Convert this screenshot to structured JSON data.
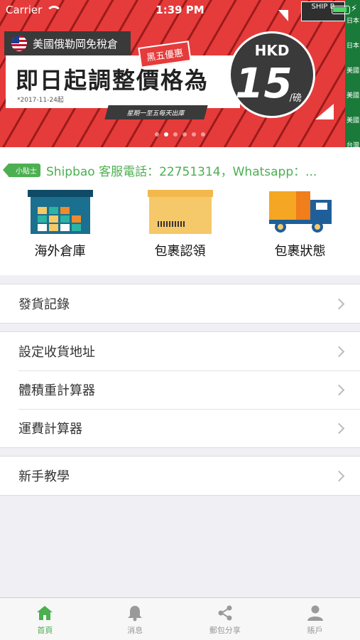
{
  "status_bar": {
    "carrier": "Carrier",
    "time": "1:39 PM"
  },
  "banner": {
    "top_tag": "美國俄勒岡免稅倉",
    "headline": "即日起調整價格為",
    "date": "*2017-11-24起",
    "promo_tag": "黑五優惠",
    "schedule": "星期一至五每天出庫",
    "currency": "HKD",
    "price": "15",
    "unit": "/磅",
    "logo_text": "SHIP B",
    "side_items": [
      "日本",
      "日本",
      "美國",
      "美國",
      "美國",
      "台灣"
    ],
    "slide_count": 6,
    "active_slide": 1
  },
  "notice": {
    "badge": "小貼士",
    "text": "Shipbao 客服電話：22751314，Whatsapp：..."
  },
  "features": [
    {
      "label": "海外倉庫",
      "icon": "warehouse-icon"
    },
    {
      "label": "包裹認領",
      "icon": "parcel-icon"
    },
    {
      "label": "包裹狀態",
      "icon": "truck-icon"
    }
  ],
  "menu_groups": [
    [
      "發貨記錄"
    ],
    [
      "設定收貨地址",
      "體積重計算器",
      "運費計算器"
    ],
    [
      "新手教學"
    ]
  ],
  "tabs": [
    {
      "label": "首頁",
      "icon": "home-icon",
      "active": true
    },
    {
      "label": "消息",
      "icon": "bell-icon",
      "active": false
    },
    {
      "label": "郵包分享",
      "icon": "share-icon",
      "active": false
    },
    {
      "label": "賬戶",
      "icon": "account-icon",
      "active": false
    }
  ],
  "colors": {
    "accent": "#4caf50",
    "banner_red": "#e63b3b"
  }
}
